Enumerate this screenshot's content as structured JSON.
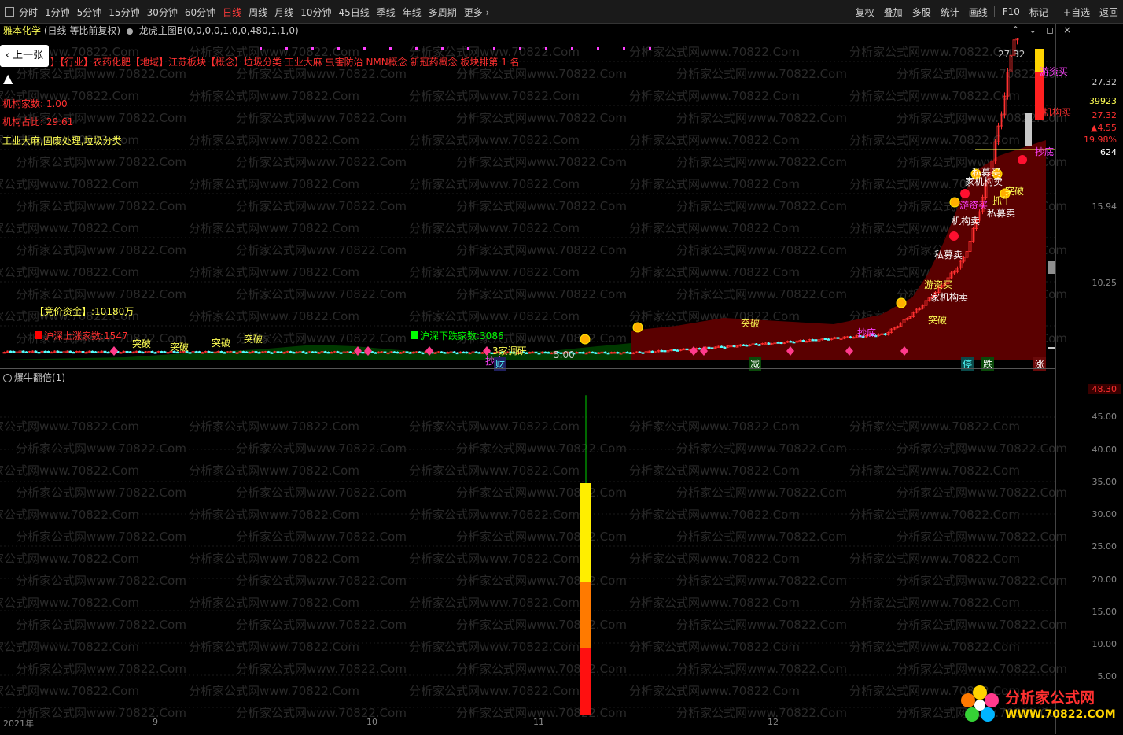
{
  "toolbar": {
    "periods": [
      "分时",
      "1分钟",
      "5分钟",
      "15分钟",
      "30分钟",
      "60分钟",
      "日线",
      "周线",
      "月线",
      "10分钟",
      "45日线",
      "季线",
      "年线",
      "多周期",
      "更多"
    ],
    "active_period": "日线",
    "tools": [
      "复权",
      "叠加",
      "多股",
      "统计",
      "画线",
      "F10",
      "标记",
      "+自选",
      "返回"
    ]
  },
  "header": {
    "stock_name": "雅本化学",
    "mode": "(日线 等比前复权)",
    "indicator": "龙虎主图B(0,0,0,0,1,0,0,480,1,1,0)"
  },
  "prev_button": "上一张",
  "info": {
    "line": "】【行业】农药化肥【地域】江苏板块【概念】垃圾分类 工业大麻 虫害防治 NMN概念 新冠药概念  板块排第  1  名",
    "inst_count": "机构家数: 1.00",
    "inst_ratio": "机构占比: 29.61",
    "concepts": "工业大麻,固废处理,垃圾分类",
    "auction": "【竞价资金】:10180万",
    "up_count": "沪深上涨家数:1547",
    "down_count": "沪深下跌家数:3086"
  },
  "annotations": [
    {
      "text": "突破",
      "color": "#ffff54"
    },
    {
      "text": "突破",
      "color": "#ffff54"
    },
    {
      "text": "突破",
      "color": "#ffff54"
    },
    {
      "text": "突破",
      "color": "#ffff54"
    },
    {
      "text": "3家调研",
      "color": "#ffff54"
    },
    {
      "text": "抄底",
      "color": "#ff40ff"
    },
    {
      "text": "5.00",
      "color": "#c8c8c8"
    },
    {
      "text": "游资买",
      "color": "#ffff54"
    },
    {
      "text": "私募卖",
      "color": "#ffffff"
    },
    {
      "text": "机构卖",
      "color": "#ffffff"
    },
    {
      "text": "突破",
      "color": "#ffff54"
    },
    {
      "text": "抄底",
      "color": "#ff40ff"
    },
    {
      "text": "突破",
      "color": "#ffff54"
    },
    {
      "text": "家机构卖",
      "color": "#ffffff"
    },
    {
      "text": "游资买",
      "color": "#ff40ff"
    },
    {
      "text": "私募买",
      "color": "#ffffff"
    },
    {
      "text": "私募卖",
      "color": "#ffffff"
    },
    {
      "text": "家机构卖",
      "color": "#ffffff"
    },
    {
      "text": "突破",
      "color": "#ffff54"
    },
    {
      "text": "抓牛",
      "color": "#ffff54"
    },
    {
      "text": "游资买",
      "color": "#ff40ff"
    },
    {
      "text": "机构买",
      "color": "#ff3030"
    },
    {
      "text": "抄底",
      "color": "#ff40ff"
    },
    {
      "text": "27.32",
      "color": "#c8c8c8"
    }
  ],
  "bottom_marks": [
    "财",
    "减",
    "停",
    "跌",
    "涨"
  ],
  "axis": {
    "main": [
      "27.32",
      "39923",
      "27.32",
      "▲4.55",
      "19.98%",
      "624",
      "15.94",
      "10.25"
    ],
    "sub": [
      "48.30",
      "45.00",
      "40.00",
      "35.00",
      "30.00",
      "25.00",
      "20.00",
      "15.00",
      "10.00",
      "5.00"
    ]
  },
  "sub_indicator": "爆牛翻倍(1)",
  "x_labels": [
    "2021年",
    "9",
    "10",
    "11",
    "12"
  ],
  "logo": {
    "title": "分析家公式网",
    "url": "WWW.70822.COM"
  },
  "watermark_text": "分析家公式网www.70822.Com",
  "colors": {
    "up": "#ff3030",
    "down": "#54ffff",
    "bull_zone": "#5a0000",
    "bear_zone": "#003a00"
  }
}
